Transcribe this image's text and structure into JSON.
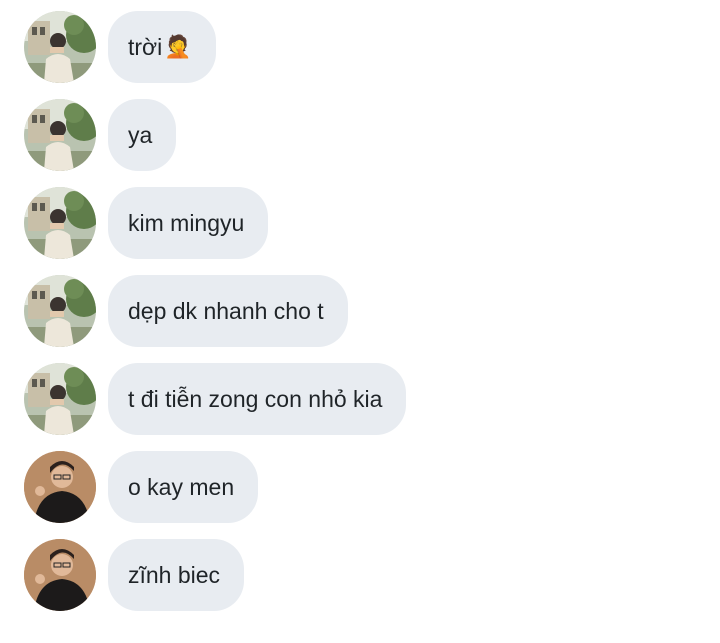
{
  "messages": [
    {
      "avatar": "avatar-a",
      "text": "trời",
      "emoji": "🤦"
    },
    {
      "avatar": "avatar-a",
      "text": "ya"
    },
    {
      "avatar": "avatar-a",
      "text": "kim mingyu"
    },
    {
      "avatar": "avatar-a",
      "text": "dẹp dk nhanh cho t"
    },
    {
      "avatar": "avatar-a",
      "text": "t đi tiễn zong con nhỏ kia"
    },
    {
      "avatar": "avatar-b",
      "text": "o kay men"
    },
    {
      "avatar": "avatar-b",
      "text": "zĩnh biec"
    }
  ],
  "colors": {
    "bubble": "#e8ecf1",
    "text": "#1f2428",
    "background": "#ffffff"
  }
}
